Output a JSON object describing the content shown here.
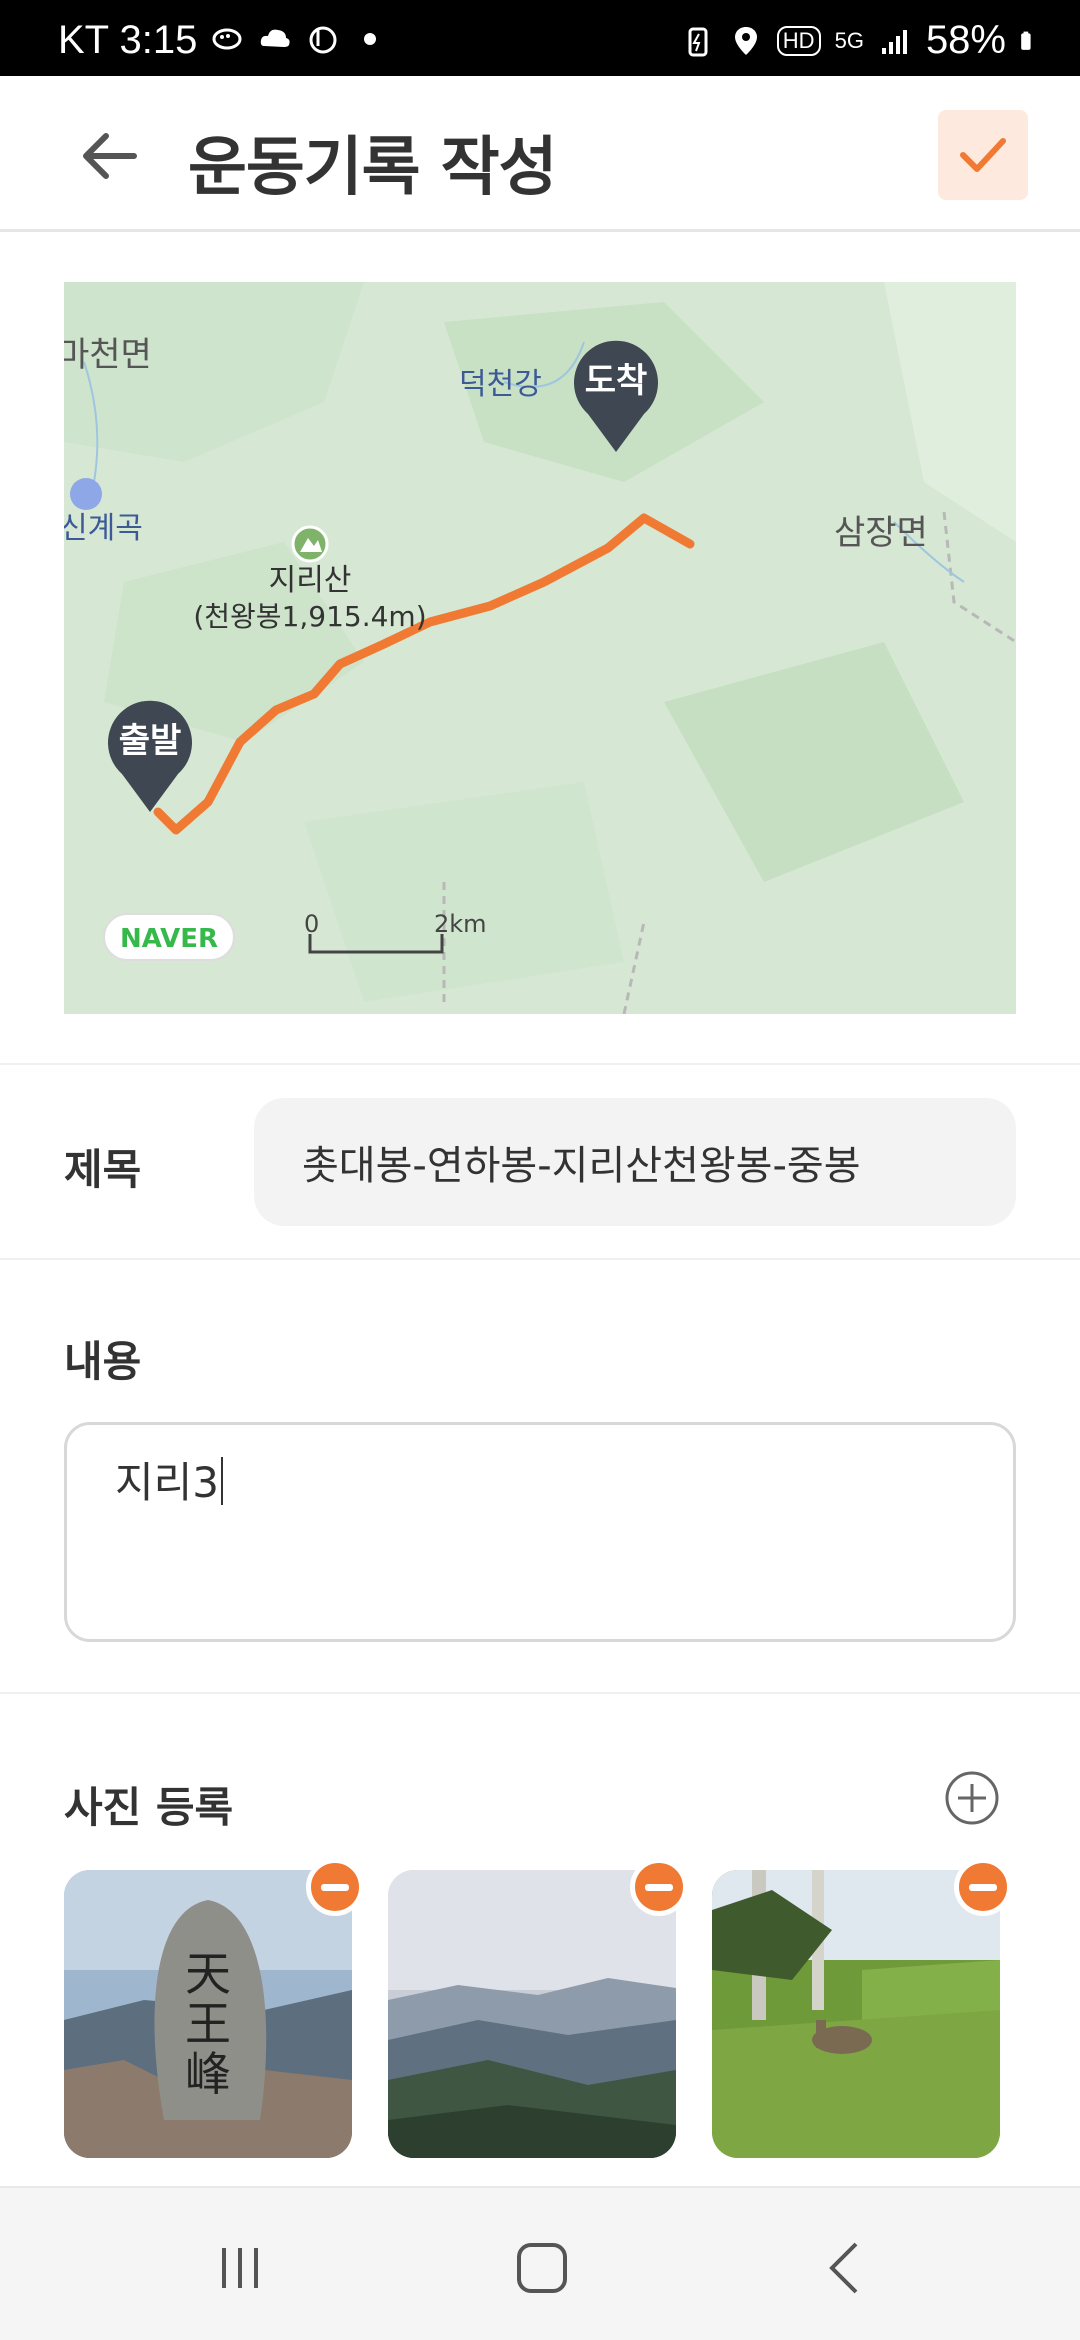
{
  "status_bar": {
    "carrier_time": "KT 3:15",
    "battery_percent": "58%",
    "network": "5G",
    "hd_label": "HD"
  },
  "header": {
    "title": "운동기록 작성",
    "back_icon": "arrow-left-icon",
    "confirm_icon": "check-icon",
    "accent_color": "#f07a34"
  },
  "map": {
    "start_label": "출발",
    "end_label": "도착",
    "place_labels": [
      "마천면",
      "신계곡",
      "덕천강",
      "삼장면"
    ],
    "mountain_name": "지리산",
    "mountain_detail": "(천왕봉1,915.4m)",
    "provider": "NAVER",
    "scale_start": "0",
    "scale_end": "2km",
    "route_color": "#f07a34"
  },
  "form": {
    "title_label": "제목",
    "title_value": "촛대봉-연하봉-지리산천왕봉-중봉",
    "content_label": "내용",
    "content_value": "지리3",
    "photos_label": "사진 등록",
    "add_photo_icon": "plus-circle-icon",
    "remove_photo_icon": "minus-circle-icon",
    "photos": [
      "summit-stone-photo",
      "mountain-range-photo",
      "meadow-deer-photo"
    ]
  },
  "nav": {
    "recents_icon": "recents-icon",
    "home_icon": "home-icon",
    "back_icon": "back-icon"
  }
}
